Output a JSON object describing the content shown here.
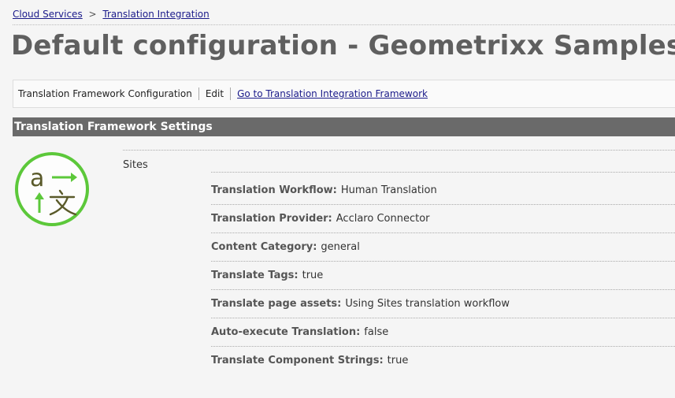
{
  "breadcrumb": {
    "items": [
      "Cloud Services",
      "Translation Integration"
    ],
    "separator": ">"
  },
  "page_title": "Default configuration - Geometrixx Samples",
  "toolbar": {
    "config_label": "Translation Framework Configuration",
    "edit_label": "Edit",
    "goto_link": "Go to Translation Integration Framework"
  },
  "section": {
    "title": "Translation Framework Settings"
  },
  "logo": {
    "icon": "translation-icon",
    "ring_color": "#5cc83a",
    "arrow_color": "#5cc83a",
    "glyph_color": "#5a5a2a"
  },
  "sites": {
    "label": "Sites",
    "settings": [
      {
        "key": "Translation Workflow:",
        "value": "Human Translation"
      },
      {
        "key": "Translation Provider:",
        "value": "Acclaro Connector"
      },
      {
        "key": "Content Category:",
        "value": "general"
      },
      {
        "key": "Translate Tags:",
        "value": "true"
      },
      {
        "key": "Translate page assets:",
        "value": "Using Sites translation workflow"
      },
      {
        "key": "Auto-execute Translation:",
        "value": "false"
      },
      {
        "key": "Translate Component Strings:",
        "value": "true"
      }
    ]
  },
  "colors": {
    "link": "#1a1a8a",
    "section_header_bg": "#6a6a6a",
    "title": "#5f5f5f"
  }
}
